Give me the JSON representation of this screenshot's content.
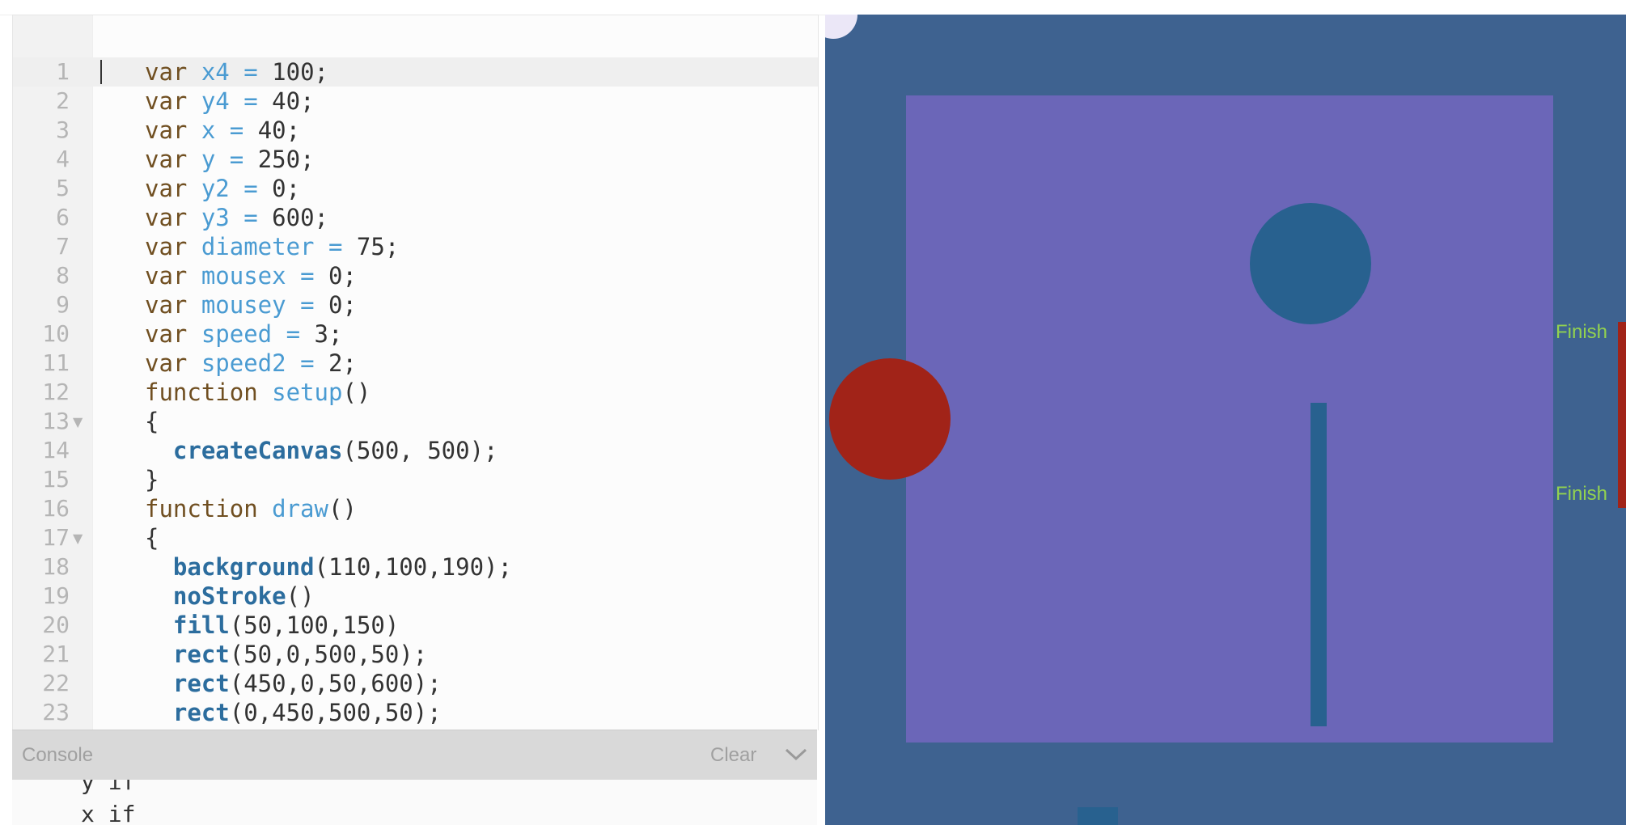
{
  "editor": {
    "lines": [
      {
        "n": "1",
        "tokens": [
          [
            "kw",
            "var "
          ],
          [
            "vn",
            "x4"
          ],
          [
            "op",
            " = "
          ],
          [
            "num",
            "100"
          ],
          [
            "txt",
            ";"
          ]
        ]
      },
      {
        "n": "2",
        "tokens": [
          [
            "kw",
            "var "
          ],
          [
            "vn",
            "y4"
          ],
          [
            "op",
            " = "
          ],
          [
            "num",
            "40"
          ],
          [
            "txt",
            ";"
          ]
        ]
      },
      {
        "n": "3",
        "tokens": [
          [
            "kw",
            "var "
          ],
          [
            "vn",
            "x"
          ],
          [
            "op",
            " = "
          ],
          [
            "num",
            "40"
          ],
          [
            "txt",
            ";"
          ]
        ]
      },
      {
        "n": "4",
        "tokens": [
          [
            "kw",
            "var "
          ],
          [
            "vn",
            "y"
          ],
          [
            "op",
            " = "
          ],
          [
            "num",
            "250"
          ],
          [
            "txt",
            ";"
          ]
        ]
      },
      {
        "n": "5",
        "tokens": [
          [
            "kw",
            "var "
          ],
          [
            "vn",
            "y2"
          ],
          [
            "op",
            " = "
          ],
          [
            "num",
            "0"
          ],
          [
            "txt",
            ";"
          ]
        ]
      },
      {
        "n": "6",
        "tokens": [
          [
            "kw",
            "var "
          ],
          [
            "vn",
            "y3"
          ],
          [
            "op",
            " = "
          ],
          [
            "num",
            "600"
          ],
          [
            "txt",
            ";"
          ]
        ]
      },
      {
        "n": "7",
        "tokens": [
          [
            "kw",
            "var "
          ],
          [
            "vn",
            "diameter"
          ],
          [
            "op",
            " = "
          ],
          [
            "num",
            "75"
          ],
          [
            "txt",
            ";"
          ]
        ]
      },
      {
        "n": "8",
        "tokens": [
          [
            "kw",
            "var "
          ],
          [
            "vn",
            "mousex"
          ],
          [
            "op",
            " = "
          ],
          [
            "num",
            "0"
          ],
          [
            "txt",
            ";"
          ]
        ]
      },
      {
        "n": "9",
        "tokens": [
          [
            "kw",
            "var "
          ],
          [
            "vn",
            "mousey"
          ],
          [
            "op",
            " = "
          ],
          [
            "num",
            "0"
          ],
          [
            "txt",
            ";"
          ]
        ]
      },
      {
        "n": "10",
        "tokens": [
          [
            "kw",
            "var "
          ],
          [
            "vn",
            "speed"
          ],
          [
            "op",
            " = "
          ],
          [
            "num",
            "3"
          ],
          [
            "txt",
            ";"
          ]
        ]
      },
      {
        "n": "11",
        "tokens": [
          [
            "kw",
            "var "
          ],
          [
            "vn",
            "speed2"
          ],
          [
            "op",
            " = "
          ],
          [
            "num",
            "2"
          ],
          [
            "txt",
            ";"
          ]
        ]
      },
      {
        "n": "12",
        "tokens": [
          [
            "kw",
            "function "
          ],
          [
            "vn",
            "setup"
          ],
          [
            "txt",
            "()"
          ]
        ]
      },
      {
        "n": "13",
        "fold": true,
        "tokens": [
          [
            "txt",
            "{"
          ]
        ]
      },
      {
        "n": "14",
        "tokens": [
          [
            "txt",
            "  "
          ],
          [
            "fnc",
            "createCanvas"
          ],
          [
            "txt",
            "(500, 500);"
          ]
        ]
      },
      {
        "n": "15",
        "tokens": [
          [
            "txt",
            "}"
          ]
        ]
      },
      {
        "n": "16",
        "tokens": [
          [
            "kw",
            "function "
          ],
          [
            "vn",
            "draw"
          ],
          [
            "txt",
            "()"
          ]
        ]
      },
      {
        "n": "17",
        "fold": true,
        "tokens": [
          [
            "txt",
            "{"
          ]
        ]
      },
      {
        "n": "18",
        "tokens": [
          [
            "txt",
            "  "
          ],
          [
            "fnc",
            "background"
          ],
          [
            "txt",
            "(110,100,190);"
          ]
        ]
      },
      {
        "n": "19",
        "tokens": [
          [
            "txt",
            "  "
          ],
          [
            "fnc",
            "noStroke"
          ],
          [
            "txt",
            "()"
          ]
        ]
      },
      {
        "n": "20",
        "tokens": [
          [
            "txt",
            "  "
          ],
          [
            "fnc",
            "fill"
          ],
          [
            "txt",
            "(50,100,150)"
          ]
        ]
      },
      {
        "n": "21",
        "tokens": [
          [
            "txt",
            "  "
          ],
          [
            "fnc",
            "rect"
          ],
          [
            "txt",
            "(50,0,500,50);"
          ]
        ]
      },
      {
        "n": "22",
        "tokens": [
          [
            "txt",
            "  "
          ],
          [
            "fnc",
            "rect"
          ],
          [
            "txt",
            "(450,0,50,600);"
          ]
        ]
      },
      {
        "n": "23",
        "tokens": [
          [
            "txt",
            "  "
          ],
          [
            "fnc",
            "rect"
          ],
          [
            "txt",
            "(0,450,500,50);"
          ]
        ]
      }
    ]
  },
  "console": {
    "label": "Console",
    "clear_label": "Clear",
    "lines": [
      "y if",
      "x if"
    ]
  },
  "preview": {
    "colors": {
      "outer": "#3e6290",
      "inner": "#6b66b8",
      "blue_shape": "#28618f",
      "red_shape": "#a12318",
      "finish_text": "#93d34f",
      "finish_bar": "#a12318",
      "corner": "#ebe7f7"
    },
    "finish_labels": [
      "Finish",
      "Finish"
    ]
  }
}
